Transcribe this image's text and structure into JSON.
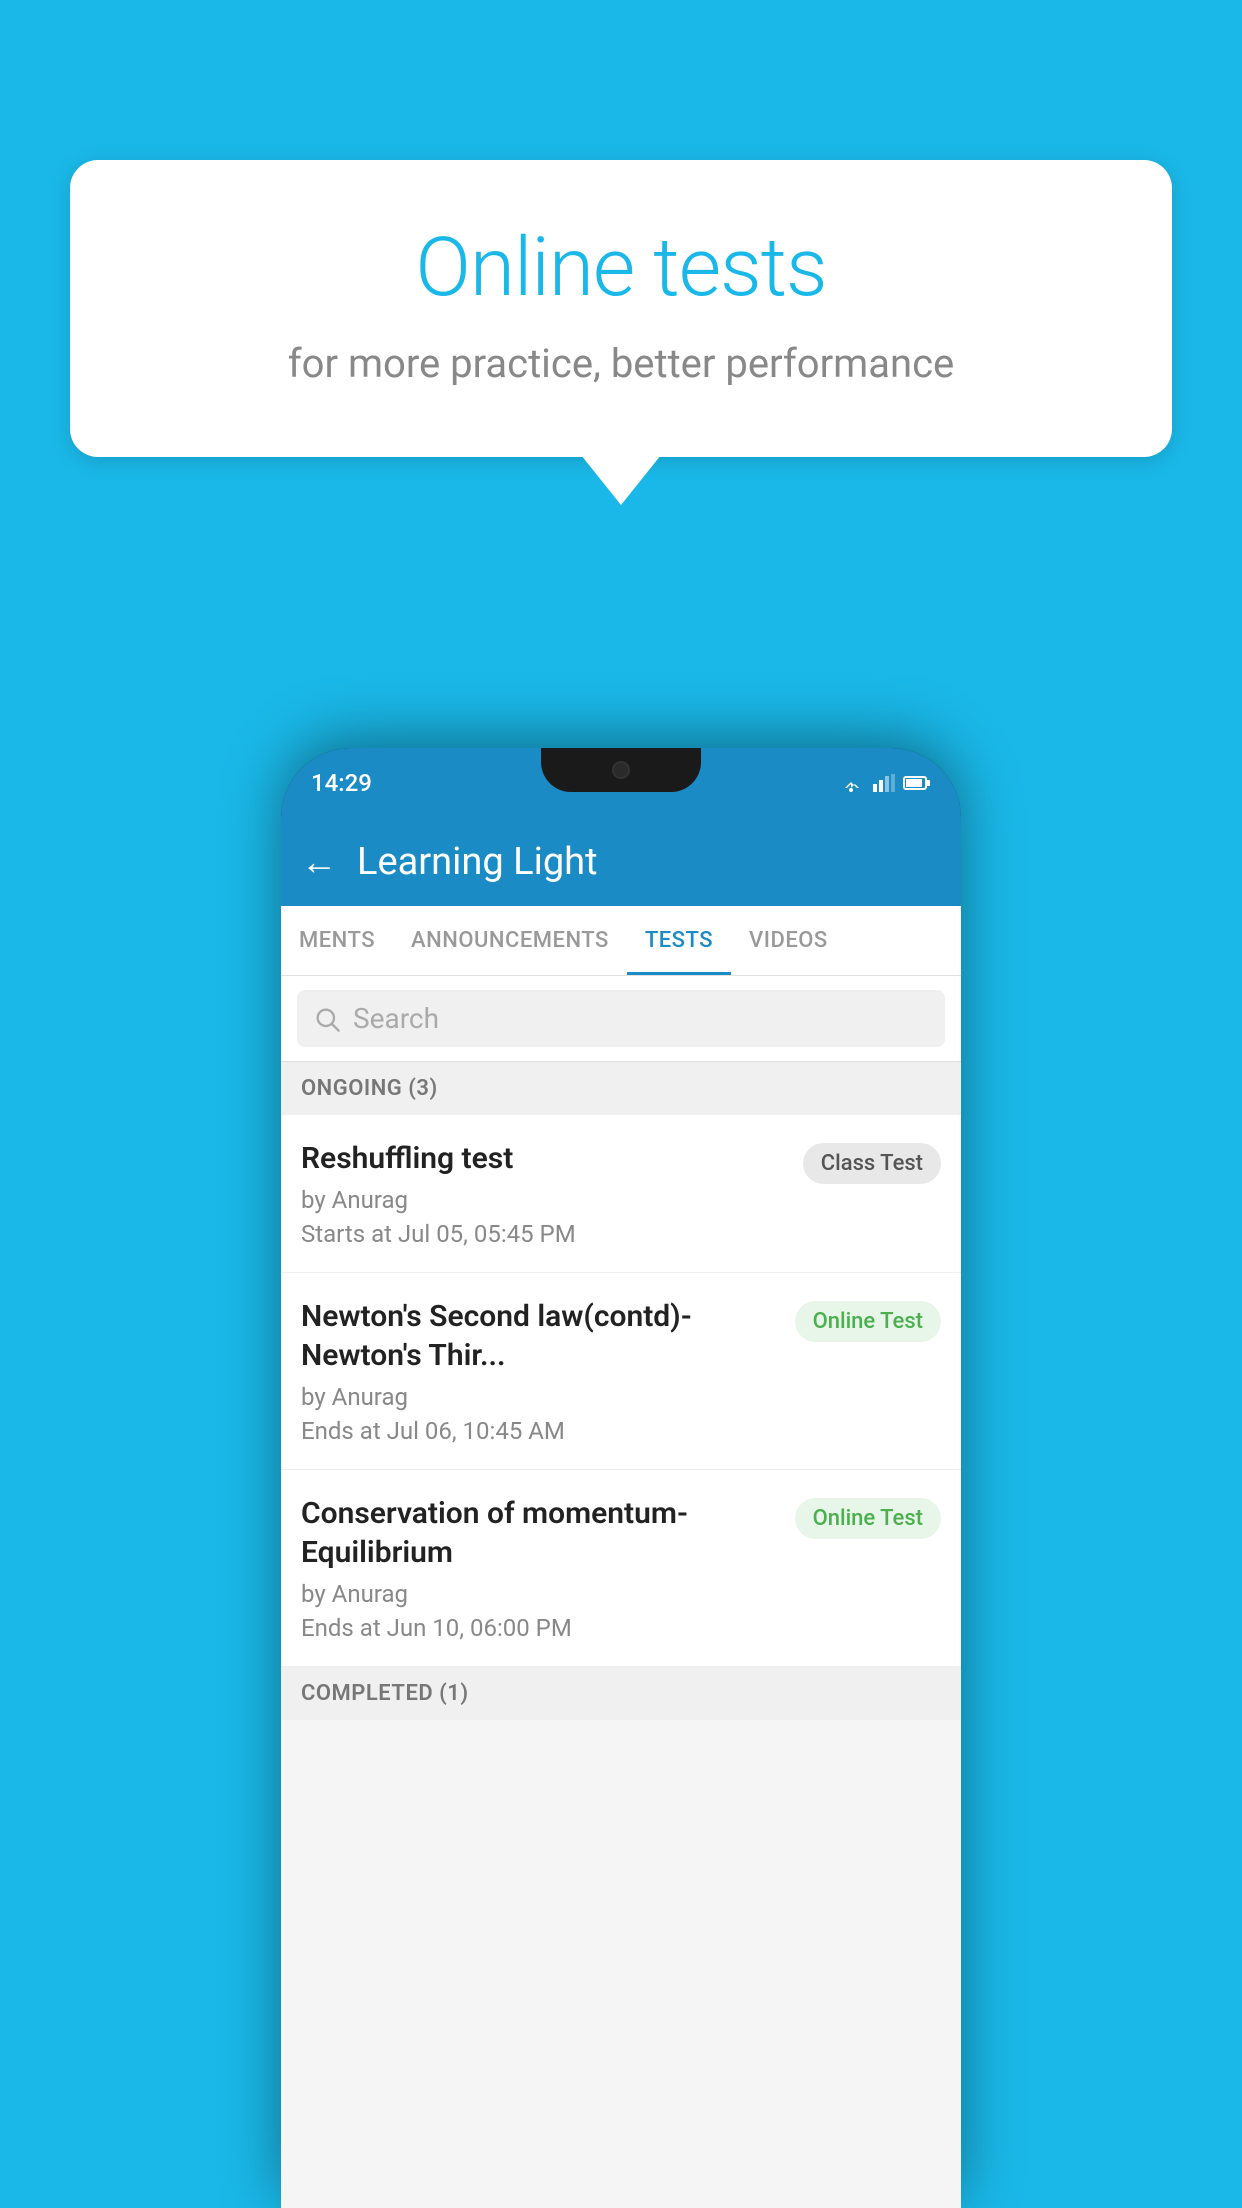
{
  "background_color": "#1ab8e8",
  "bubble": {
    "title": "Online tests",
    "subtitle": "for more practice, better performance"
  },
  "phone": {
    "time": "14:29",
    "app_name": "Learning Light",
    "back_label": "←",
    "tabs": [
      {
        "label": "MENTS",
        "active": false
      },
      {
        "label": "ANNOUNCEMENTS",
        "active": false
      },
      {
        "label": "TESTS",
        "active": true
      },
      {
        "label": "VIDEOS",
        "active": false
      }
    ],
    "search": {
      "placeholder": "Search"
    },
    "ongoing_section": "ONGOING (3)",
    "tests": [
      {
        "title": "Reshuffling test",
        "by": "by Anurag",
        "time": "Starts at  Jul 05, 05:45 PM",
        "badge": "Class Test",
        "badge_type": "class"
      },
      {
        "title": "Newton's Second law(contd)-Newton's Thir...",
        "by": "by Anurag",
        "time": "Ends at  Jul 06, 10:45 AM",
        "badge": "Online Test",
        "badge_type": "online"
      },
      {
        "title": "Conservation of momentum-Equilibrium",
        "by": "by Anurag",
        "time": "Ends at  Jun 10, 06:00 PM",
        "badge": "Online Test",
        "badge_type": "online"
      }
    ],
    "completed_section": "COMPLETED (1)"
  }
}
